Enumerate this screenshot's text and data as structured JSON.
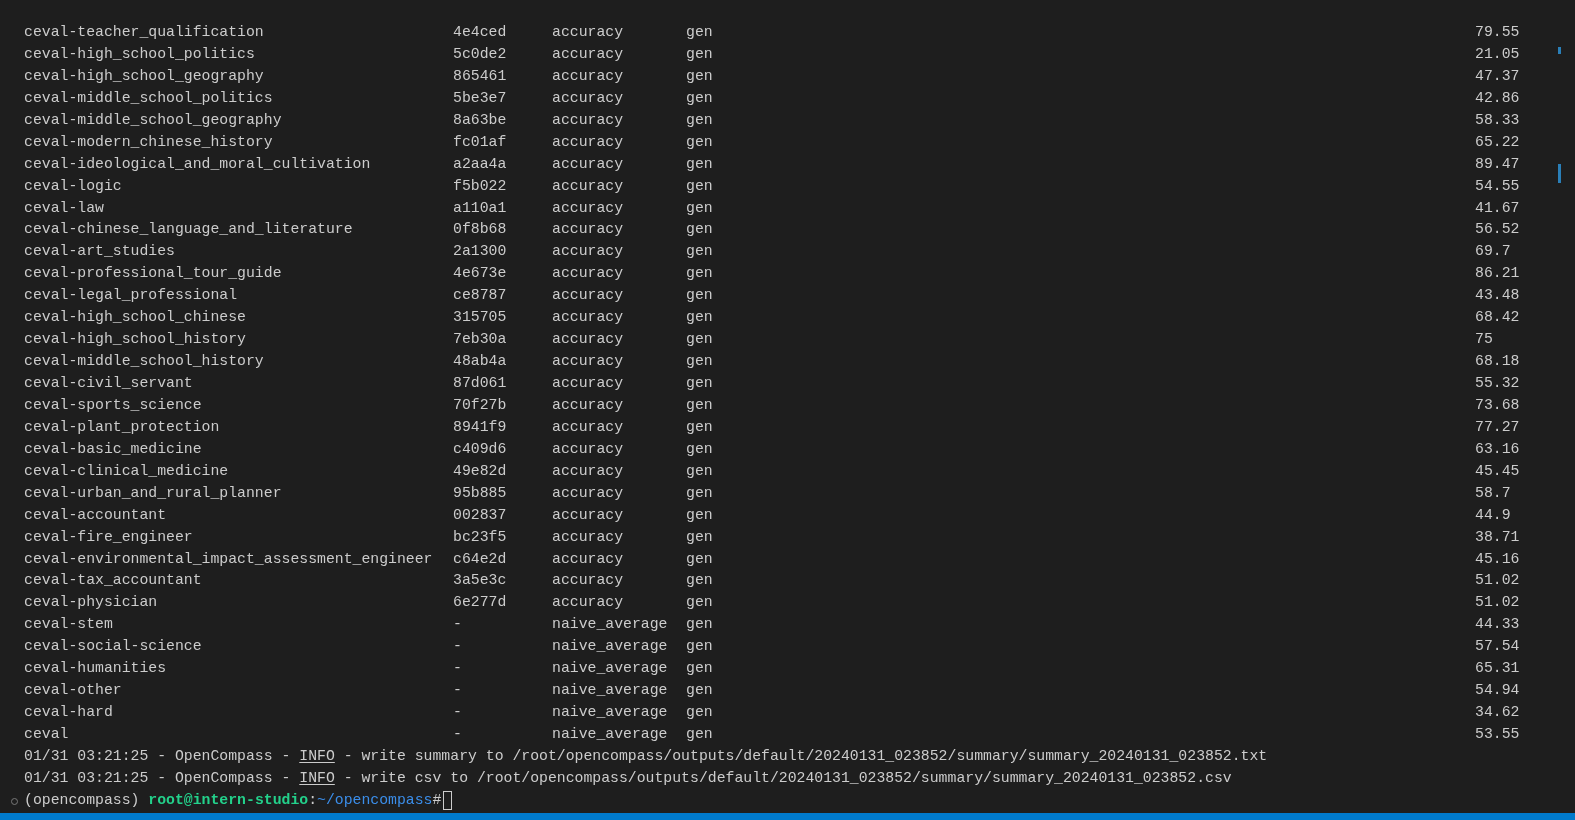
{
  "rows": [
    {
      "name": "ceval-teacher_qualification",
      "version": "4e4ced",
      "metric": "accuracy",
      "mode": "gen",
      "value": "79.55"
    },
    {
      "name": "ceval-high_school_politics",
      "version": "5c0de2",
      "metric": "accuracy",
      "mode": "gen",
      "value": "21.05"
    },
    {
      "name": "ceval-high_school_geography",
      "version": "865461",
      "metric": "accuracy",
      "mode": "gen",
      "value": "47.37"
    },
    {
      "name": "ceval-middle_school_politics",
      "version": "5be3e7",
      "metric": "accuracy",
      "mode": "gen",
      "value": "42.86"
    },
    {
      "name": "ceval-middle_school_geography",
      "version": "8a63be",
      "metric": "accuracy",
      "mode": "gen",
      "value": "58.33"
    },
    {
      "name": "ceval-modern_chinese_history",
      "version": "fc01af",
      "metric": "accuracy",
      "mode": "gen",
      "value": "65.22"
    },
    {
      "name": "ceval-ideological_and_moral_cultivation",
      "version": "a2aa4a",
      "metric": "accuracy",
      "mode": "gen",
      "value": "89.47"
    },
    {
      "name": "ceval-logic",
      "version": "f5b022",
      "metric": "accuracy",
      "mode": "gen",
      "value": "54.55"
    },
    {
      "name": "ceval-law",
      "version": "a110a1",
      "metric": "accuracy",
      "mode": "gen",
      "value": "41.67"
    },
    {
      "name": "ceval-chinese_language_and_literature",
      "version": "0f8b68",
      "metric": "accuracy",
      "mode": "gen",
      "value": "56.52"
    },
    {
      "name": "ceval-art_studies",
      "version": "2a1300",
      "metric": "accuracy",
      "mode": "gen",
      "value": "69.7"
    },
    {
      "name": "ceval-professional_tour_guide",
      "version": "4e673e",
      "metric": "accuracy",
      "mode": "gen",
      "value": "86.21"
    },
    {
      "name": "ceval-legal_professional",
      "version": "ce8787",
      "metric": "accuracy",
      "mode": "gen",
      "value": "43.48"
    },
    {
      "name": "ceval-high_school_chinese",
      "version": "315705",
      "metric": "accuracy",
      "mode": "gen",
      "value": "68.42"
    },
    {
      "name": "ceval-high_school_history",
      "version": "7eb30a",
      "metric": "accuracy",
      "mode": "gen",
      "value": "75"
    },
    {
      "name": "ceval-middle_school_history",
      "version": "48ab4a",
      "metric": "accuracy",
      "mode": "gen",
      "value": "68.18"
    },
    {
      "name": "ceval-civil_servant",
      "version": "87d061",
      "metric": "accuracy",
      "mode": "gen",
      "value": "55.32"
    },
    {
      "name": "ceval-sports_science",
      "version": "70f27b",
      "metric": "accuracy",
      "mode": "gen",
      "value": "73.68"
    },
    {
      "name": "ceval-plant_protection",
      "version": "8941f9",
      "metric": "accuracy",
      "mode": "gen",
      "value": "77.27"
    },
    {
      "name": "ceval-basic_medicine",
      "version": "c409d6",
      "metric": "accuracy",
      "mode": "gen",
      "value": "63.16"
    },
    {
      "name": "ceval-clinical_medicine",
      "version": "49e82d",
      "metric": "accuracy",
      "mode": "gen",
      "value": "45.45"
    },
    {
      "name": "ceval-urban_and_rural_planner",
      "version": "95b885",
      "metric": "accuracy",
      "mode": "gen",
      "value": "58.7"
    },
    {
      "name": "ceval-accountant",
      "version": "002837",
      "metric": "accuracy",
      "mode": "gen",
      "value": "44.9"
    },
    {
      "name": "ceval-fire_engineer",
      "version": "bc23f5",
      "metric": "accuracy",
      "mode": "gen",
      "value": "38.71"
    },
    {
      "name": "ceval-environmental_impact_assessment_engineer",
      "version": "c64e2d",
      "metric": "accuracy",
      "mode": "gen",
      "value": "45.16"
    },
    {
      "name": "ceval-tax_accountant",
      "version": "3a5e3c",
      "metric": "accuracy",
      "mode": "gen",
      "value": "51.02"
    },
    {
      "name": "ceval-physician",
      "version": "6e277d",
      "metric": "accuracy",
      "mode": "gen",
      "value": "51.02"
    },
    {
      "name": "ceval-stem",
      "version": "-",
      "metric": "naive_average",
      "mode": "gen",
      "value": "44.33"
    },
    {
      "name": "ceval-social-science",
      "version": "-",
      "metric": "naive_average",
      "mode": "gen",
      "value": "57.54"
    },
    {
      "name": "ceval-humanities",
      "version": "-",
      "metric": "naive_average",
      "mode": "gen",
      "value": "65.31"
    },
    {
      "name": "ceval-other",
      "version": "-",
      "metric": "naive_average",
      "mode": "gen",
      "value": "54.94"
    },
    {
      "name": "ceval-hard",
      "version": "-",
      "metric": "naive_average",
      "mode": "gen",
      "value": "34.62"
    },
    {
      "name": "ceval",
      "version": "-",
      "metric": "naive_average",
      "mode": "gen",
      "value": "53.55"
    }
  ],
  "log_lines": [
    {
      "prefix": "01/31 03:21:25 - OpenCompass - ",
      "level": "INFO",
      "message": " - write summary to /root/opencompass/outputs/default/20240131_023852/summary/summary_20240131_023852.txt"
    },
    {
      "prefix": "01/31 03:21:25 - OpenCompass - ",
      "level": "INFO",
      "message": " - write csv to /root/opencompass/outputs/default/20240131_023852/summary/summary_20240131_023852.csv"
    }
  ],
  "prompt": {
    "env": "(opencompass)",
    "user_host": "root@intern-studio",
    "separator": ":",
    "path": "~/opencompass",
    "symbol": "#"
  }
}
